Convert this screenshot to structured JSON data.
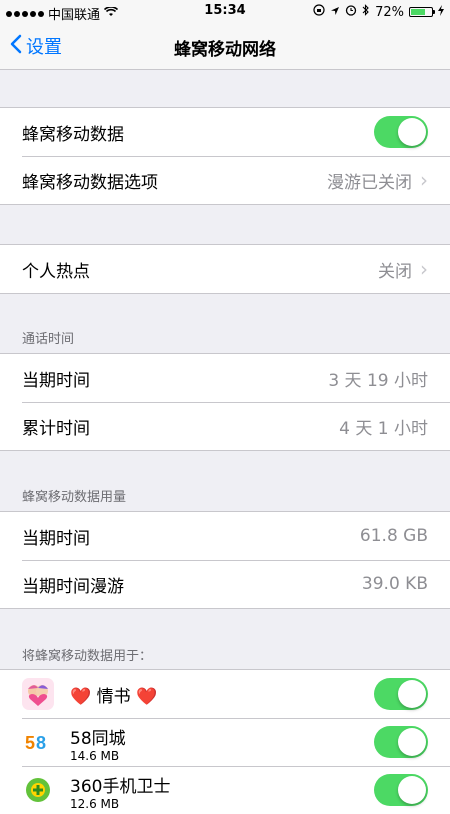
{
  "status_bar": {
    "carrier": "中国联通",
    "time": "15:34",
    "battery": "72%"
  },
  "nav": {
    "back_label": "设置",
    "title": "蜂窝移动网络"
  },
  "section1": {
    "cellular_data_label": "蜂窝移动数据",
    "cellular_options_label": "蜂窝移动数据选项",
    "cellular_options_value": "漫游已关闭"
  },
  "section2": {
    "hotspot_label": "个人热点",
    "hotspot_value": "关闭"
  },
  "call_time": {
    "header": "通话时间",
    "current_label": "当期时间",
    "current_value": "3 天 19 小时",
    "total_label": "累计时间",
    "total_value": "4 天 1 小时"
  },
  "data_usage": {
    "header": "蜂窝移动数据用量",
    "current_label": "当期时间",
    "current_value": "61.8 GB",
    "roaming_label": "当期时间漫游",
    "roaming_value": "39.0 KB"
  },
  "apps": {
    "header": "将蜂窝移动数据用于：",
    "items": [
      {
        "name": "❤️ 情书 ❤️",
        "usage": "",
        "icon": "heart-couple-icon"
      },
      {
        "name": "58同城",
        "usage": "14.6 MB",
        "icon": "58-logo-icon"
      },
      {
        "name": "360手机卫士",
        "usage": "12.6 MB",
        "icon": "360-shield-icon"
      }
    ]
  },
  "colors": {
    "toggle_on": "#4cd964",
    "accent": "#0076ff"
  }
}
